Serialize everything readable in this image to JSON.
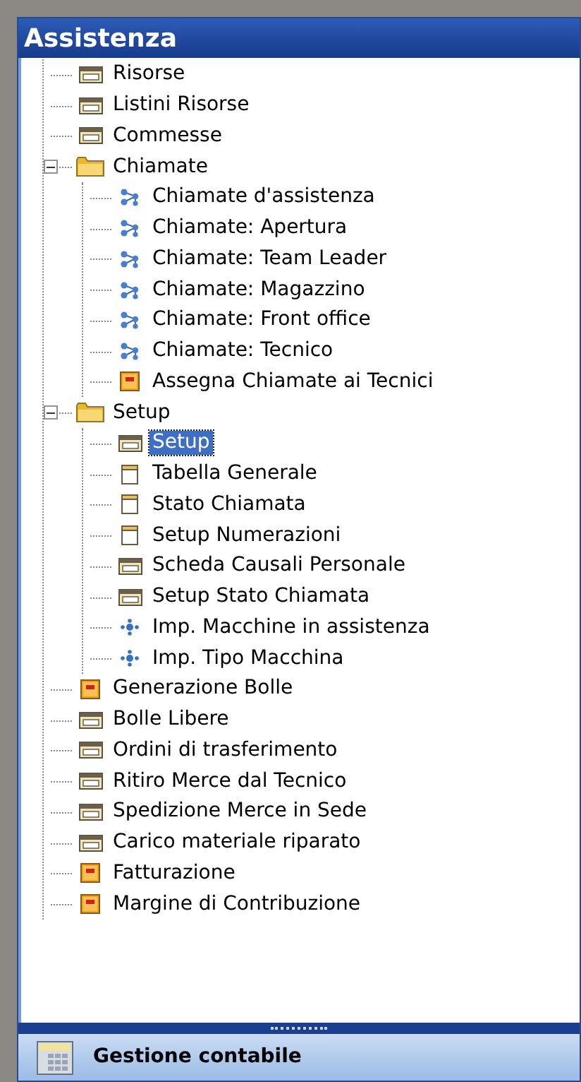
{
  "panel": {
    "title": "Assistenza"
  },
  "tree": [
    {
      "label": "Risorse",
      "kind": "form",
      "selected": false
    },
    {
      "label": "Listini Risorse",
      "kind": "form",
      "selected": false
    },
    {
      "label": "Commesse",
      "kind": "form",
      "selected": false
    },
    {
      "label": "Chiamate",
      "kind": "folder",
      "selected": false,
      "expanded": true,
      "children": [
        {
          "label": "Chiamate d'assistenza",
          "kind": "flow",
          "selected": false
        },
        {
          "label": "Chiamate: Apertura",
          "kind": "flow",
          "selected": false
        },
        {
          "label": "Chiamate: Team Leader",
          "kind": "flow",
          "selected": false
        },
        {
          "label": "Chiamate: Magazzino",
          "kind": "flow",
          "selected": false
        },
        {
          "label": "Chiamate: Front office",
          "kind": "flow",
          "selected": false
        },
        {
          "label": "Chiamate: Tecnico",
          "kind": "flow",
          "selected": false
        },
        {
          "label": "Assegna Chiamate ai Tecnici",
          "kind": "report",
          "selected": false
        }
      ]
    },
    {
      "label": "Setup",
      "kind": "folder",
      "selected": false,
      "expanded": true,
      "children": [
        {
          "label": "Setup",
          "kind": "form",
          "selected": true
        },
        {
          "label": "Tabella Generale",
          "kind": "table",
          "selected": false
        },
        {
          "label": "Stato Chiamata",
          "kind": "table",
          "selected": false
        },
        {
          "label": "Setup Numerazioni",
          "kind": "table",
          "selected": false
        },
        {
          "label": "Scheda Causali Personale",
          "kind": "form",
          "selected": false
        },
        {
          "label": "Setup Stato Chiamata",
          "kind": "form",
          "selected": false
        },
        {
          "label": "Imp. Macchine in assistenza",
          "kind": "dots",
          "selected": false
        },
        {
          "label": "Imp. Tipo Macchina",
          "kind": "dots",
          "selected": false
        }
      ]
    },
    {
      "label": "Generazione Bolle",
      "kind": "report",
      "selected": false
    },
    {
      "label": "Bolle Libere",
      "kind": "form",
      "selected": false
    },
    {
      "label": "Ordini di trasferimento",
      "kind": "form",
      "selected": false
    },
    {
      "label": "Ritiro Merce dal Tecnico",
      "kind": "form",
      "selected": false
    },
    {
      "label": "Spedizione Merce in Sede",
      "kind": "form",
      "selected": false
    },
    {
      "label": "Carico materiale riparato",
      "kind": "form",
      "selected": false
    },
    {
      "label": "Fatturazione",
      "kind": "report",
      "selected": false
    },
    {
      "label": "Margine di Contribuzione",
      "kind": "report",
      "selected": false
    }
  ],
  "bottom_button": {
    "label": "Gestione contabile"
  }
}
